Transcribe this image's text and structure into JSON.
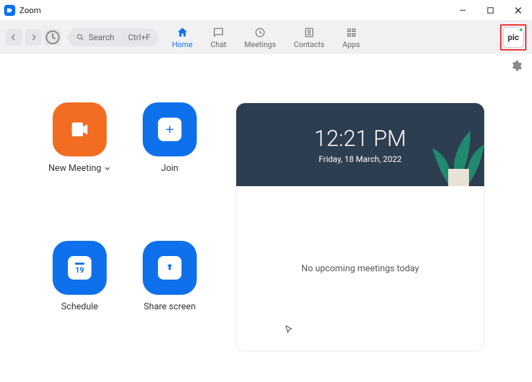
{
  "window": {
    "title": "Zoom"
  },
  "search": {
    "label": "Search",
    "shortcut": "Ctrl+F"
  },
  "tabs": {
    "home": "Home",
    "chat": "Chat",
    "meetings": "Meetings",
    "contacts": "Contacts",
    "apps": "Apps"
  },
  "avatar": {
    "text": "pic"
  },
  "actions": {
    "new_meeting": "New Meeting",
    "join": "Join",
    "schedule": "Schedule",
    "schedule_day": "19",
    "share_screen": "Share screen"
  },
  "panel": {
    "time": "12:21 PM",
    "date": "Friday, 18 March, 2022",
    "empty": "No upcoming meetings today"
  }
}
